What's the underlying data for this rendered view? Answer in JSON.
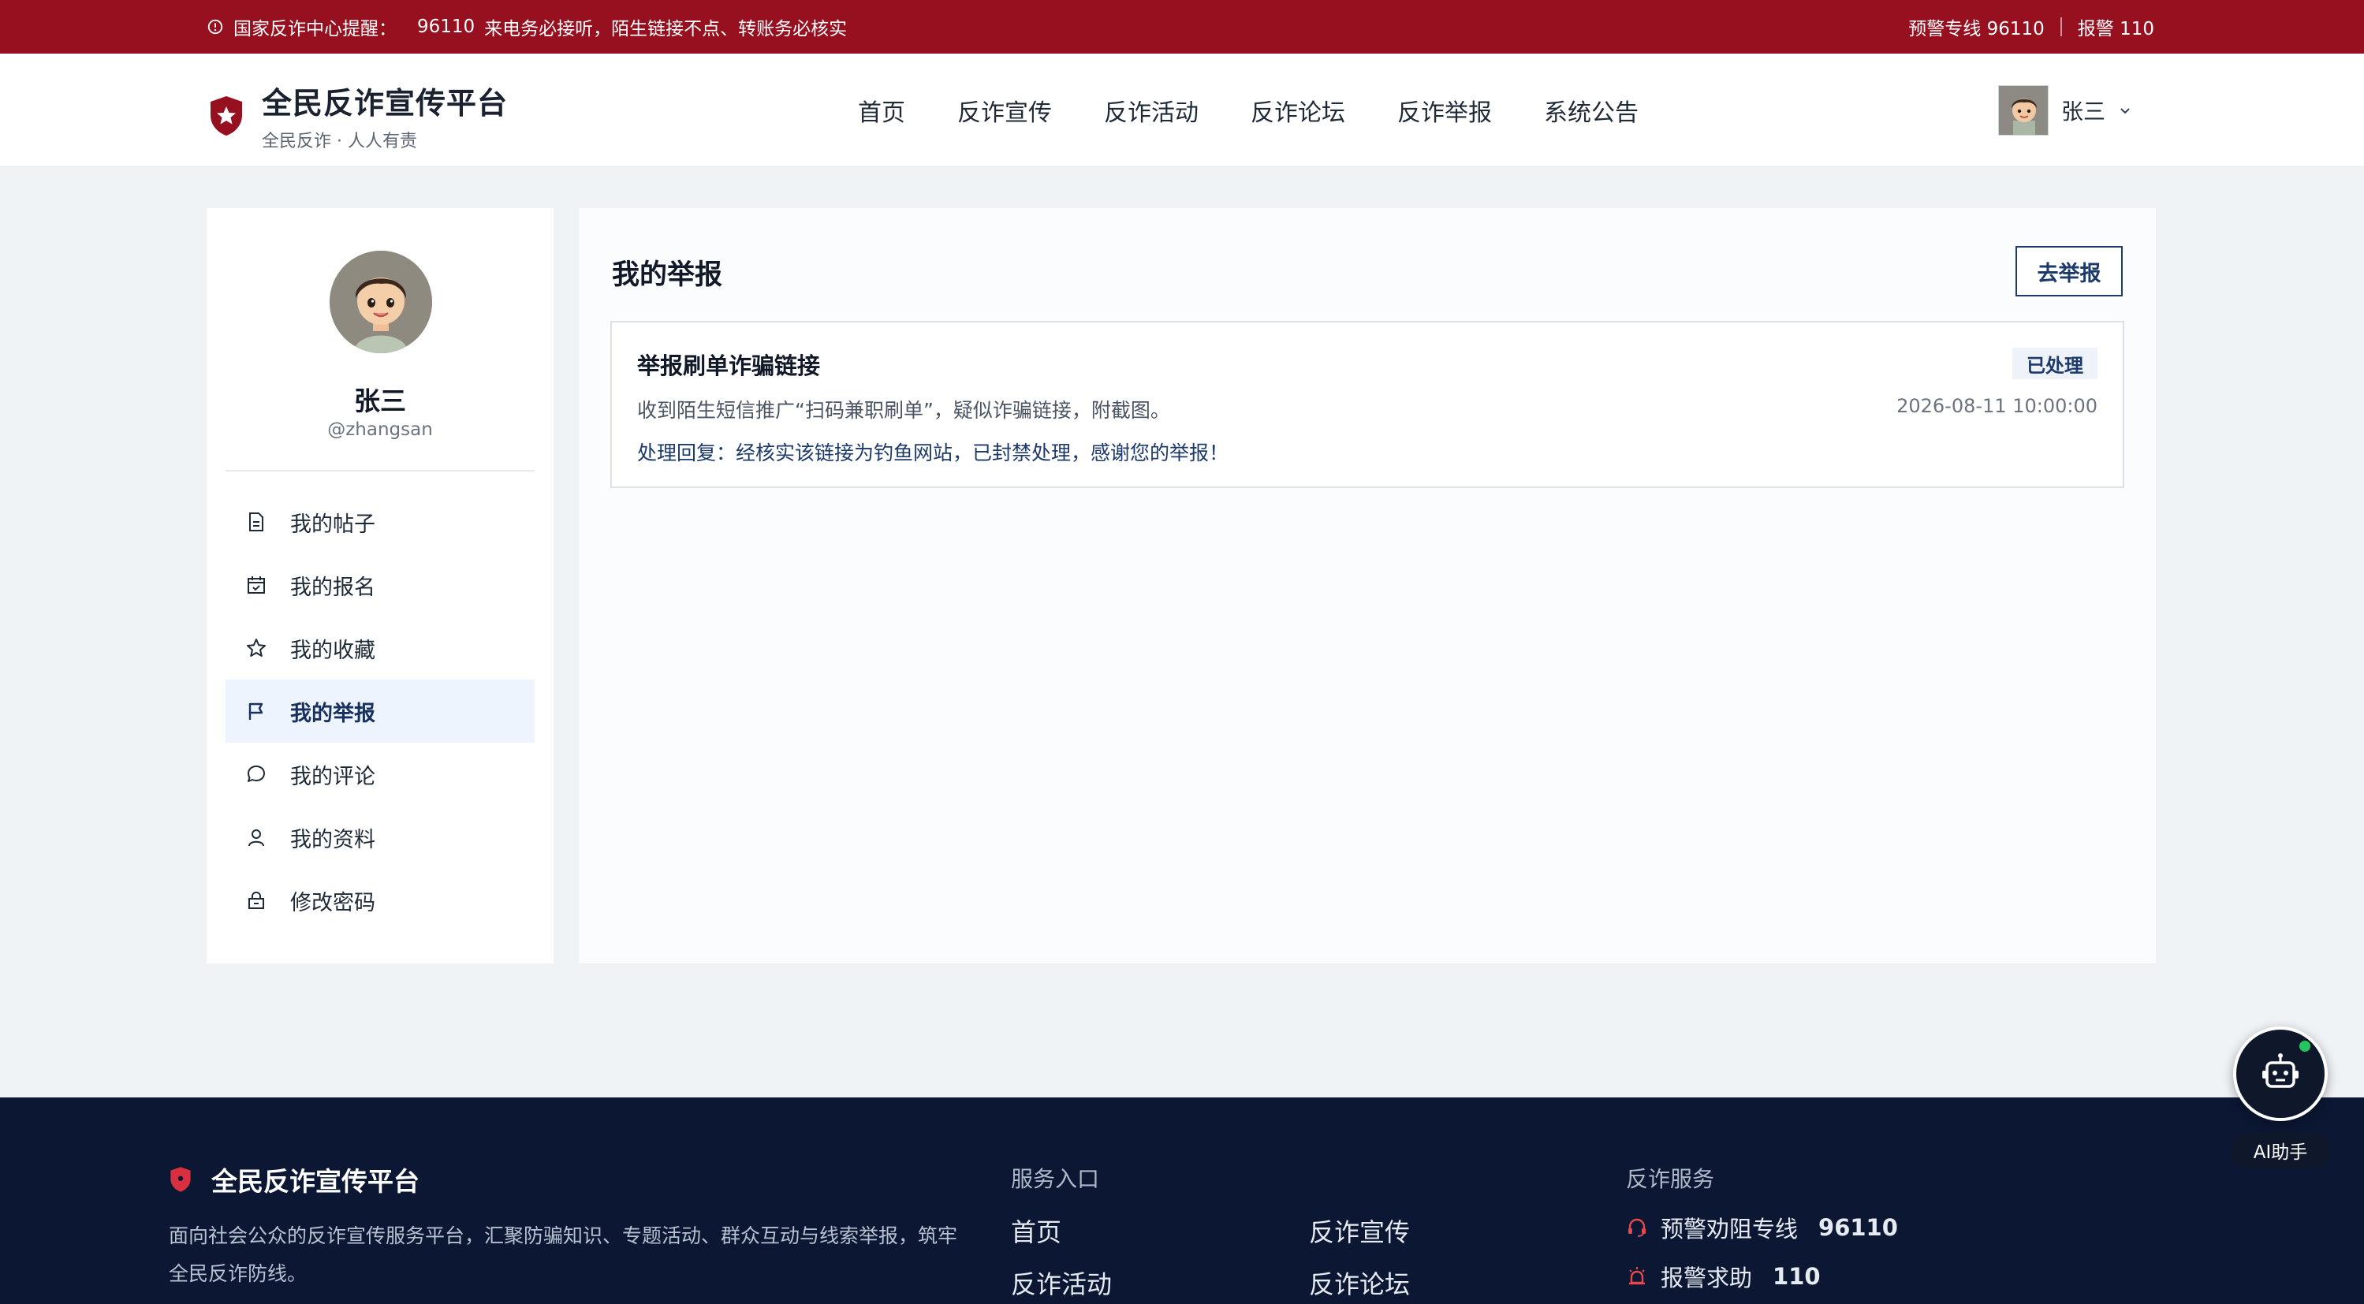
{
  "alert_bar": {
    "notice_label": "国家反诈中心提醒：",
    "notice_number": "96110",
    "notice_text": "来电务必接听，陌生链接不点、转账务必核实",
    "hotline": "预警专线 96110",
    "police": "报警 110"
  },
  "header": {
    "brand_title": "全民反诈宣传平台",
    "brand_subtitle": "全民反诈 · 人人有责",
    "nav": [
      "首页",
      "反诈宣传",
      "反诈活动",
      "反诈论坛",
      "反诈举报",
      "系统公告"
    ],
    "user_name": "张三"
  },
  "sidebar": {
    "name": "张三",
    "handle": "@zhangsan",
    "menu": [
      {
        "label": "我的帖子",
        "icon": "document-icon"
      },
      {
        "label": "我的报名",
        "icon": "calendar-icon"
      },
      {
        "label": "我的收藏",
        "icon": "star-icon"
      },
      {
        "label": "我的举报",
        "icon": "flag-icon",
        "active": true
      },
      {
        "label": "我的评论",
        "icon": "comment-icon"
      },
      {
        "label": "我的资料",
        "icon": "user-icon"
      },
      {
        "label": "修改密码",
        "icon": "lock-icon"
      }
    ]
  },
  "main": {
    "title": "我的举报",
    "report_button": "去举报",
    "reports": [
      {
        "title": "举报刷单诈骗链接",
        "status": "已处理",
        "description": "收到陌生短信推广“扫码兼职刷单”，疑似诈骗链接，附截图。",
        "time": "2026-08-11 10:00:00",
        "reply": "处理回复：经核实该链接为钓鱼网站，已封禁处理，感谢您的举报！"
      }
    ]
  },
  "footer": {
    "brand_title": "全民反诈宣传平台",
    "description": "面向社会公众的反诈宣传服务平台，汇聚防骗知识、专题活动、群众互动与线索举报，筑牢全民反诈防线。",
    "service_entry_title": "服务入口",
    "service_links": [
      "首页",
      "反诈宣传",
      "反诈活动",
      "反诈论坛"
    ],
    "anti_fraud_title": "反诈服务",
    "hotline_label": "预警劝阻专线",
    "hotline_number": "96110",
    "police_label": "报警求助",
    "police_number": "110"
  },
  "ai_assistant": {
    "label": "AI助手"
  },
  "colors": {
    "brand_red": "#96101f",
    "navy": "#1d3a6b",
    "footer_bg": "#0b1733",
    "active_bg": "#eef4fd"
  }
}
